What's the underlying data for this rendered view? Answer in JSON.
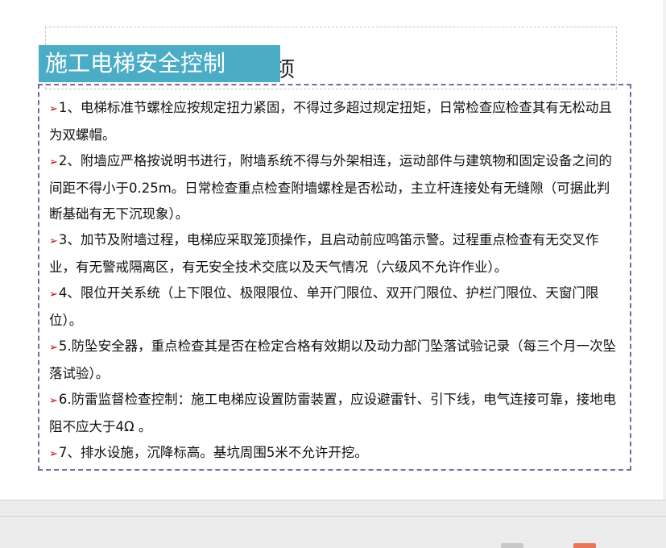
{
  "slide": {
    "title": "施工电梯安全控制",
    "hidden_heading_fragment": "项",
    "bullet_glyph": "➢",
    "items": [
      "1、电梯标准节螺栓应按规定扭力紧固，不得过多超过规定扭矩，日常检查应检查其有无松动且为双螺帽。",
      "2、附墙应严格按说明书进行，附墙系统不得与外架相连，运动部件与建筑物和固定设备之间的间距不得小于0.25m。日常检查重点检查附墙螺栓是否松动，主立杆连接处有无缝隙（可据此判断基础有无下沉现象）。",
      "3、加节及附墙过程，电梯应采取笼顶操作，且启动前应鸣笛示警。过程重点检查有无交叉作业，有无警戒隔离区，有无安全技术交底以及天气情况（六级风不允许作业）。",
      "4、限位开关系统（上下限位、极限限位、单开门限位、双开门限位、护栏门限位、天窗门限位）。",
      "5.防坠安全器，重点检查其是否在检定合格有效期以及动力部门坠落试验记录（每三个月一次坠落试验）。",
      "6.防雷监督检查控制：施工电梯应设置防雷装置，应设避雷针、引下线，电气连接可靠，接地电阻不应大于4Ω 。",
      "7、排水设施，沉降标高。基坑周围5米不允许开挖。"
    ]
  },
  "colors": {
    "banner": "#4bacc6",
    "content_border": "#8064a2",
    "bullet": "#c00000"
  }
}
